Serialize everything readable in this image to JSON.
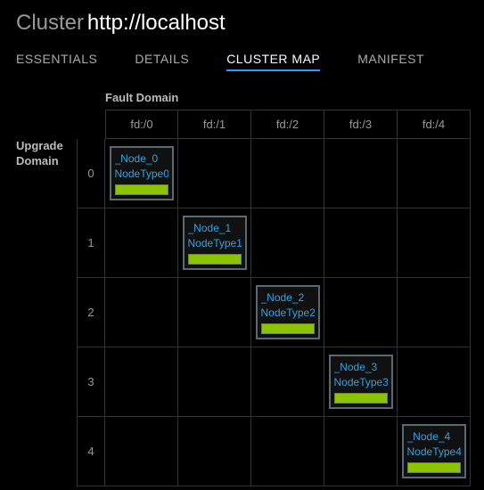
{
  "header": {
    "label": "Cluster",
    "url": "http://localhost"
  },
  "tabs": {
    "items": [
      {
        "label": "ESSENTIALS"
      },
      {
        "label": "DETAILS"
      },
      {
        "label": "CLUSTER MAP"
      },
      {
        "label": "MANIFEST"
      }
    ],
    "active_index": 2
  },
  "axes": {
    "fault_domain_label": "Fault Domain",
    "upgrade_domain_label": "Upgrade Domain",
    "fault_domains": [
      "fd:/0",
      "fd:/1",
      "fd:/2",
      "fd:/3",
      "fd:/4"
    ],
    "upgrade_domains": [
      "0",
      "1",
      "2",
      "3",
      "4"
    ]
  },
  "nodes": [
    {
      "name": "_Node_0",
      "type": "NodeType0",
      "fd": 0,
      "ud": 0,
      "health": "ok"
    },
    {
      "name": "_Node_1",
      "type": "NodeType1",
      "fd": 1,
      "ud": 1,
      "health": "ok"
    },
    {
      "name": "_Node_2",
      "type": "NodeType2",
      "fd": 2,
      "ud": 2,
      "health": "ok"
    },
    {
      "name": "_Node_3",
      "type": "NodeType3",
      "fd": 3,
      "ud": 3,
      "health": "ok"
    },
    {
      "name": "_Node_4",
      "type": "NodeType4",
      "fd": 4,
      "ud": 4,
      "health": "ok"
    }
  ],
  "colors": {
    "accent": "#3399ff",
    "link": "#2fa3e6",
    "health_ok": "#8bc500"
  }
}
